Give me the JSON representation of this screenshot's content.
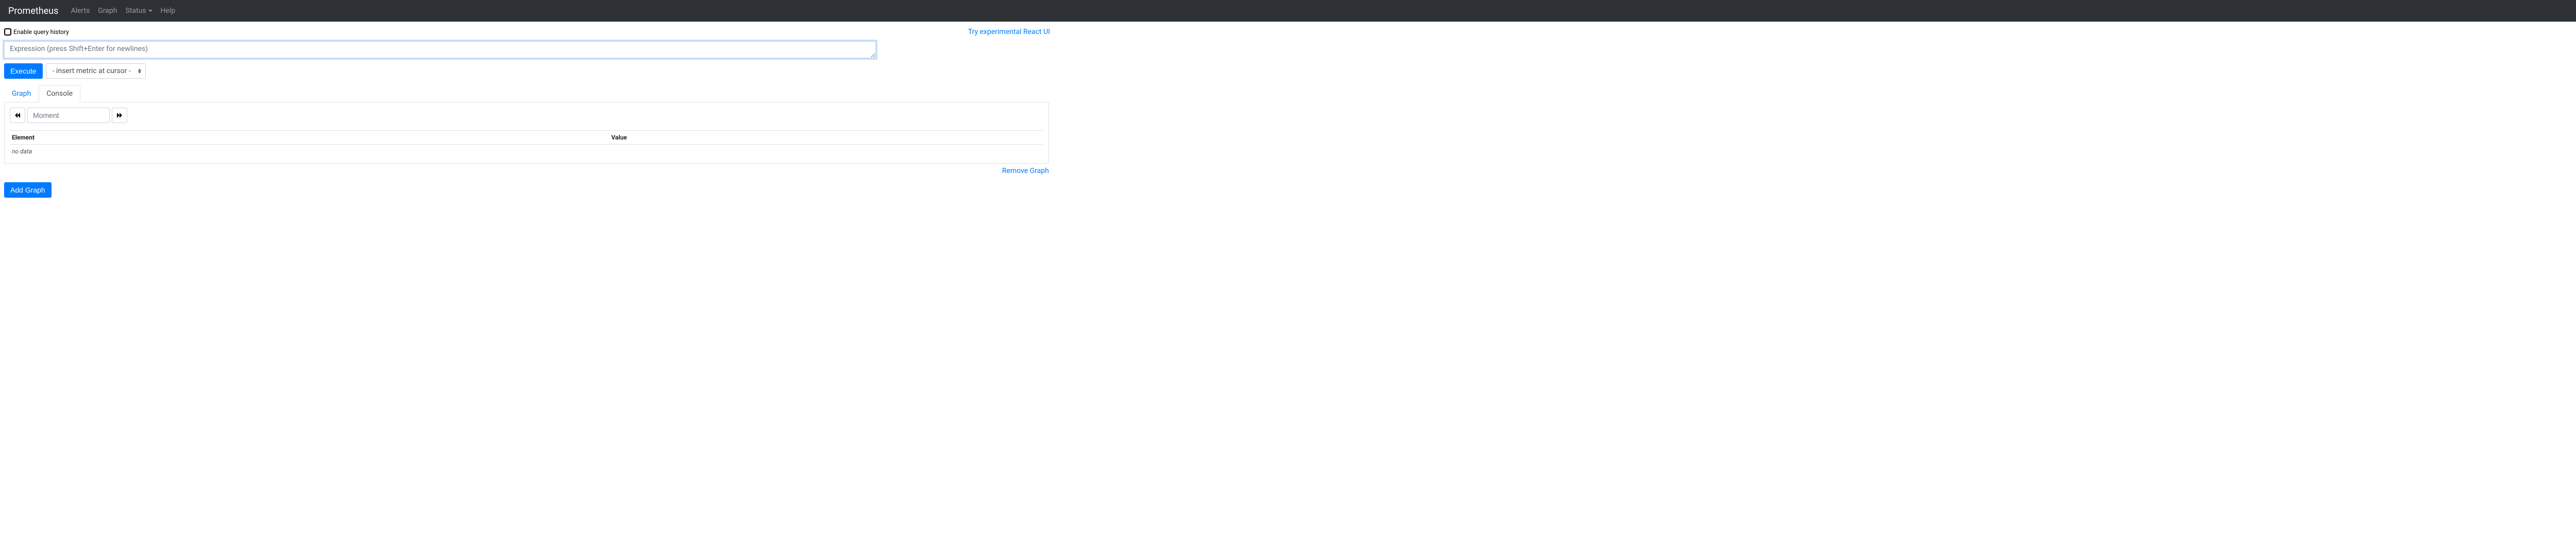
{
  "navbar": {
    "brand": "Prometheus",
    "links": {
      "alerts": "Alerts",
      "graph": "Graph",
      "status": "Status",
      "help": "Help"
    }
  },
  "top": {
    "enable_history_label": "Enable query history",
    "react_ui_link": "Try experimental React UI"
  },
  "expression": {
    "placeholder": "Expression (press Shift+Enter for newlines)"
  },
  "controls": {
    "execute_label": "Execute",
    "metric_select_label": "- insert metric at cursor -"
  },
  "tabs": {
    "graph": "Graph",
    "console": "Console"
  },
  "moment": {
    "placeholder": "Moment"
  },
  "table": {
    "header_element": "Element",
    "header_value": "Value",
    "no_data": "no data"
  },
  "actions": {
    "remove_graph": "Remove Graph",
    "add_graph": "Add Graph"
  }
}
